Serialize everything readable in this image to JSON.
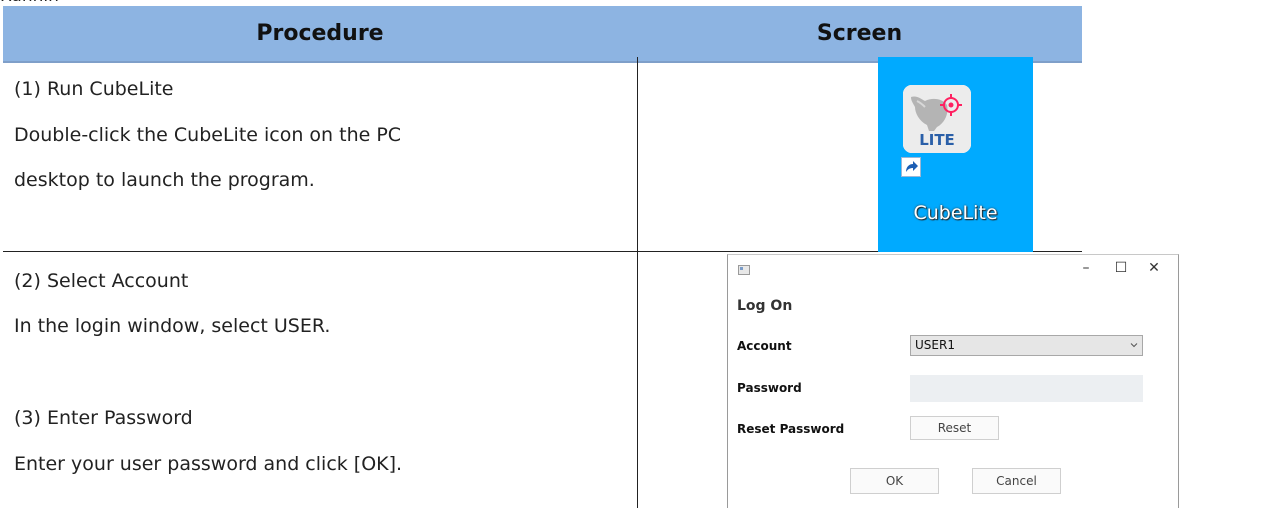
{
  "table": {
    "headers": [
      "Procedure",
      "Screen"
    ],
    "rows": [
      {
        "lines": [
          "(1) Run CubeLite",
          "Double-click the CubeLite icon on the PC",
          "desktop to launch the program."
        ]
      },
      {
        "lines": [
          "(2) Select Account",
          "In the login window, select USER.",
          "(3) Enter Password",
          "Enter your user password and click [OK]."
        ]
      }
    ]
  },
  "desktop_icon": {
    "label": "CubeLite",
    "badge_text": "LITE",
    "background_color": "#00aaff",
    "accent_color": "#ff2060"
  },
  "login_window": {
    "controls": {
      "minimize": "–",
      "maximize": "☐",
      "close": "✕"
    },
    "title": "Log On",
    "account_label": "Account",
    "account_value": "USER1",
    "password_label": "Password",
    "password_value": "",
    "reset_label": "Reset Password",
    "reset_button": "Reset",
    "ok_button": "OK",
    "cancel_button": "Cancel"
  },
  "colors": {
    "header_fill": "#8db4e2",
    "input_fill": "#eceff2"
  }
}
